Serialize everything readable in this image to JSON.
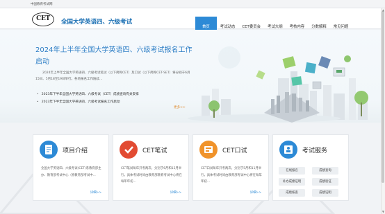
{
  "topbar": {
    "text": "中国教育考试网"
  },
  "header": {
    "logo_text": "CET",
    "site_title": "全国大学英语四、六级考试",
    "nav": [
      "首页",
      "考试动态",
      "CET委员会",
      "考试大纲",
      "考核内容",
      "分数解释",
      "常见问题"
    ]
  },
  "hero": {
    "title": "2024年上半年全国大学英语四、六级考试报名工作启动",
    "text": "2024年上半年全国大学英语四、六级考试笔试（以下简称CET）及口试（以下简称CET-SET）将分别于6月15日、5月18至19日举行。各地报名工作陆续...",
    "news": [
      "2023年下半年全国大学英语四、六级考试（CET）成绩查询有关安排",
      "2023年下半年全国大学英语四、六级考试报名工作启动"
    ],
    "more": "更多>>"
  },
  "cards": [
    {
      "title": "项目介绍",
      "text": "全国大学英语四、六级考试(CET)系教育部主办、教育部考试中心（原教育部考试中...",
      "more": "详细>>"
    },
    {
      "title": "CET笔试",
      "text": "CET笔试每年开考两次，分别于6月和12月举行，具体考试时间由教育部教育考试中心将在每年年初...",
      "more": "详细>>"
    },
    {
      "title": "CET口试",
      "text": "CET口试每年开考两次，分别于5月和11月举行，具体考试时间由教育部考试中心将在每年年初...",
      "more": "详细>>"
    },
    {
      "title": "考试服务",
      "services": [
        "在线报名",
        "成绩查询",
        "补办成绩证明",
        "成绩验证",
        "成绩核查",
        "成绩证明"
      ]
    }
  ],
  "colors": {
    "brand_blue": "#2d8ad6",
    "title_blue": "#2f7fc6",
    "accent_orange": "#e08a2c",
    "icon_red": "#e24b32",
    "icon_orange": "#f0932b"
  },
  "icons": [
    "document-icon",
    "checkmark-icon",
    "microphone-icon",
    "id-card-icon"
  ]
}
